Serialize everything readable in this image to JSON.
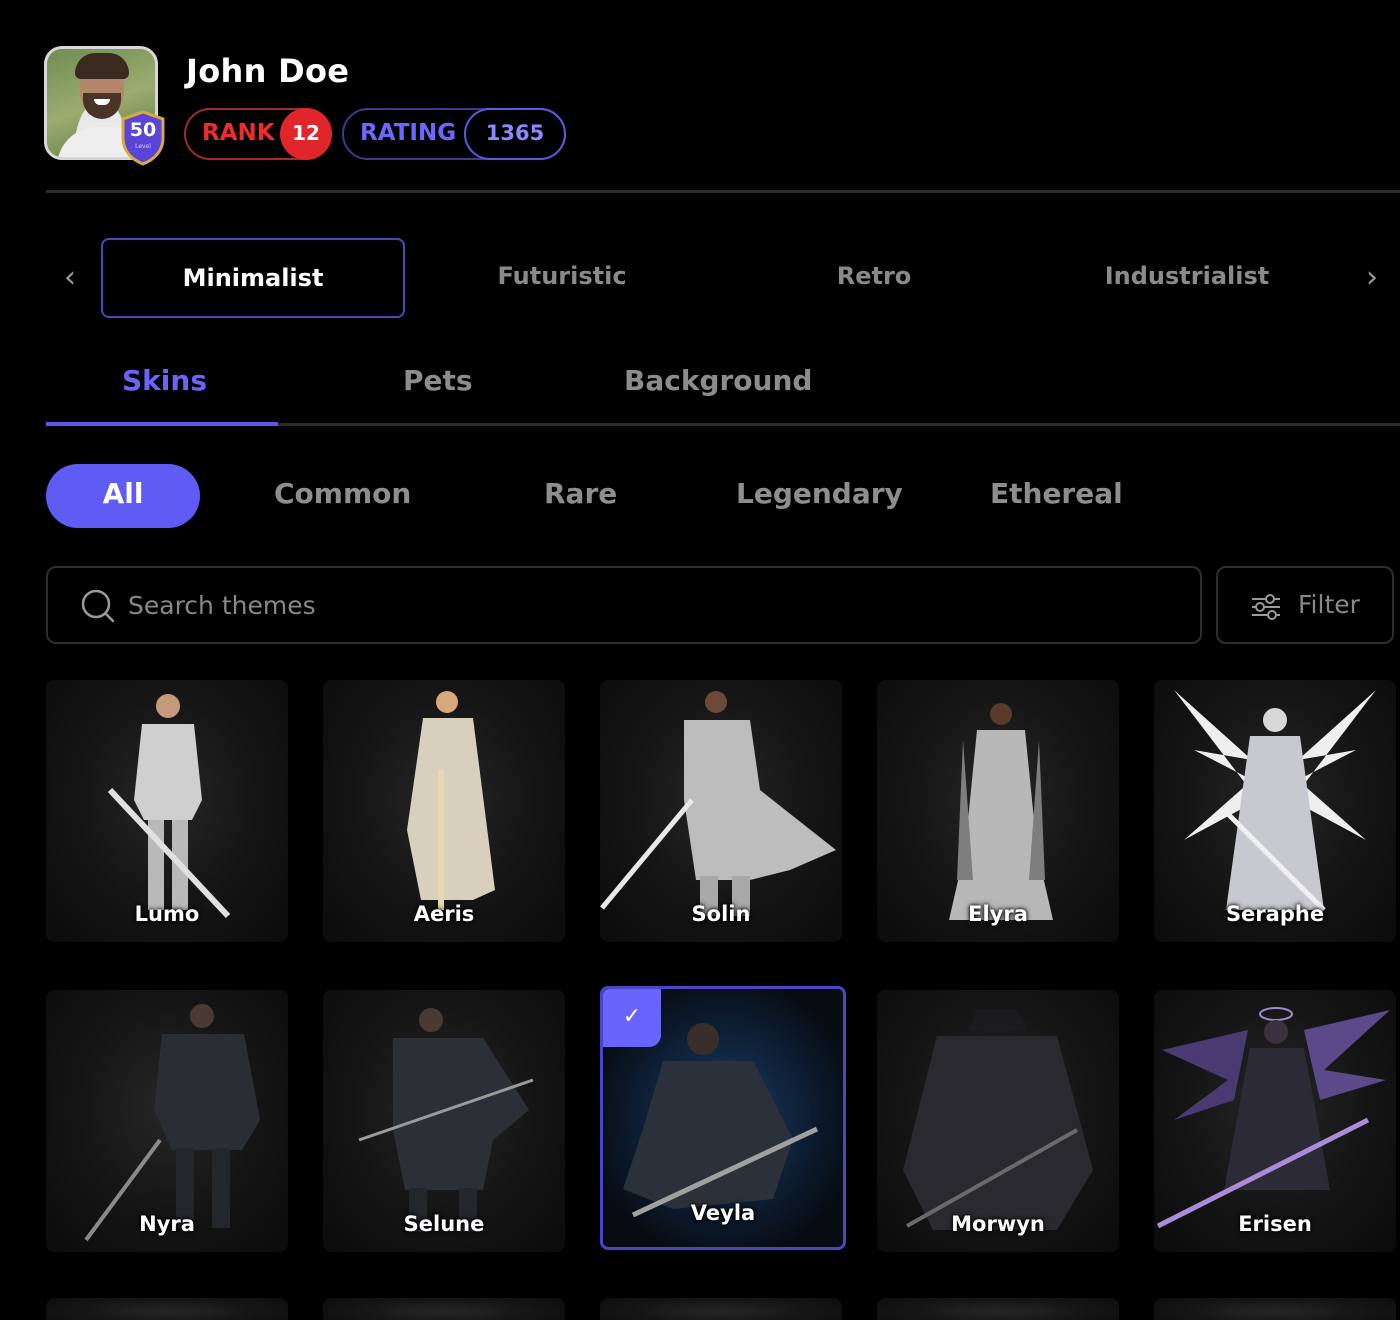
{
  "profile": {
    "name": "John Doe",
    "level": "50",
    "level_sub": "Level",
    "rank_label": "RANK",
    "rank_value": "12",
    "rating_label": "RATING",
    "rating_value": "1365"
  },
  "themes": {
    "items": [
      "Minimalist",
      "Futuristic",
      "Retro",
      "Industrialist"
    ],
    "active": "Minimalist"
  },
  "categories": {
    "items": [
      "Skins",
      "Pets",
      "Background"
    ],
    "active": "Skins"
  },
  "rarities": {
    "items": [
      "All",
      "Common",
      "Rare",
      "Legendary",
      "Ethereal"
    ],
    "active": "All"
  },
  "search": {
    "placeholder": "Search themes",
    "filter_label": "Filter"
  },
  "skins": {
    "row1": [
      "Lumo",
      "Aeris",
      "Solin",
      "Elyra",
      "Seraphe"
    ],
    "row2": [
      "Nyra",
      "Selune",
      "Veyla",
      "Morwyn",
      "Erisen"
    ],
    "selected": "Veyla"
  },
  "colors": {
    "accent": "#5f5bf5",
    "rank_red": "#e0262b",
    "background": "#000000"
  }
}
